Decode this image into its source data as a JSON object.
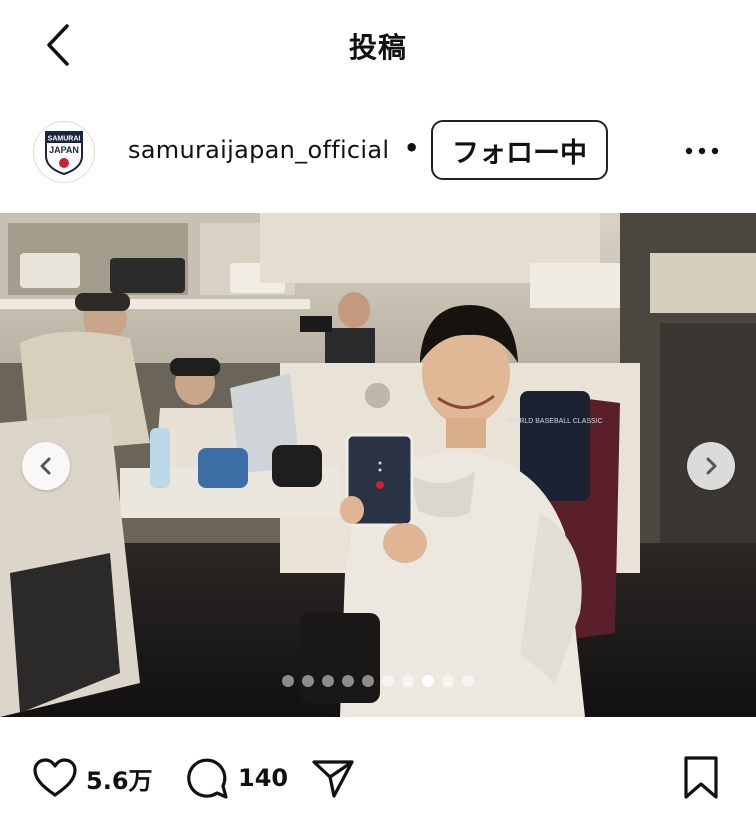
{
  "header": {
    "title": "投稿",
    "back_icon": "chevron-left-icon"
  },
  "author": {
    "username": "samuraijapan_official",
    "separator": "•",
    "follow_label": "フォロー中",
    "avatar_logo_line1": "SAMURAI",
    "avatar_logo_line2": "JAPAN",
    "more_icon": "more-horizontal-icon"
  },
  "post": {
    "carousel": {
      "total_slides": 10,
      "active_index": 7
    },
    "photo_text": {
      "jersey_logo": "WORLD BASEBALL CLASSIC"
    }
  },
  "actions": {
    "likes": "5.6万",
    "comments": "140",
    "like_icon": "heart-icon",
    "comment_icon": "comment-icon",
    "share_icon": "send-icon",
    "save_icon": "bookmark-icon"
  },
  "colors": {
    "text": "#111111",
    "brand_red": "#cf1f2e",
    "brand_navy": "#1b2440"
  }
}
